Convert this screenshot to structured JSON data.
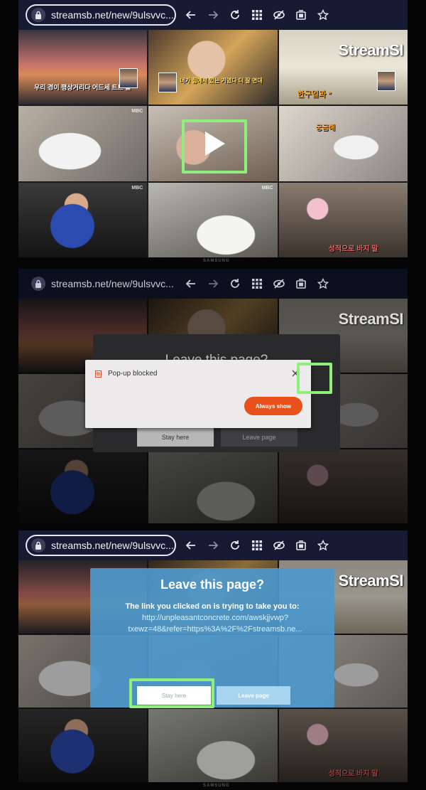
{
  "browser": {
    "url": "streamsb.net/new/9ulsvvc...",
    "icons": [
      "back-arrow-icon",
      "forward-arrow-icon",
      "reload-icon",
      "apps-grid-icon",
      "tracking-protection-icon",
      "tab-icon",
      "bookmark-star-icon"
    ]
  },
  "page": {
    "watermark_main": "Stream",
    "watermark_tail": "SI",
    "channel_tag": "MBC",
    "thumb_captions": [
      "우리 경이 평상거리다 어드세 트트 들",
      "너가 집에서 있는 거였다 더 잘 면대",
      "한구일과 *",
      "궁금해",
      "성적으로 바지 말",
      "성적으로 바지 말"
    ]
  },
  "tv": {
    "brand": "SAMSUNG"
  },
  "leave_dialog": {
    "title": "Leave this page?",
    "body": "The link you clicked on is trying to take you to:",
    "link_line1": "http://unpleasantconcrete.com/awskjjvwp?",
    "link_line2": "txewz=48&refer=https%3A%2F%2Fstreamsb.ne...",
    "stay_label": "Stay here",
    "leave_label": "Leave page"
  },
  "popup": {
    "title": "Pop-up blocked",
    "always_show_label": "Always show",
    "close_icon": "close-icon"
  },
  "colors": {
    "highlight": "#8ef07a",
    "always_show": "#e8501c",
    "dialog_blue": "#4d98cc",
    "toolbar": "#161b33"
  }
}
